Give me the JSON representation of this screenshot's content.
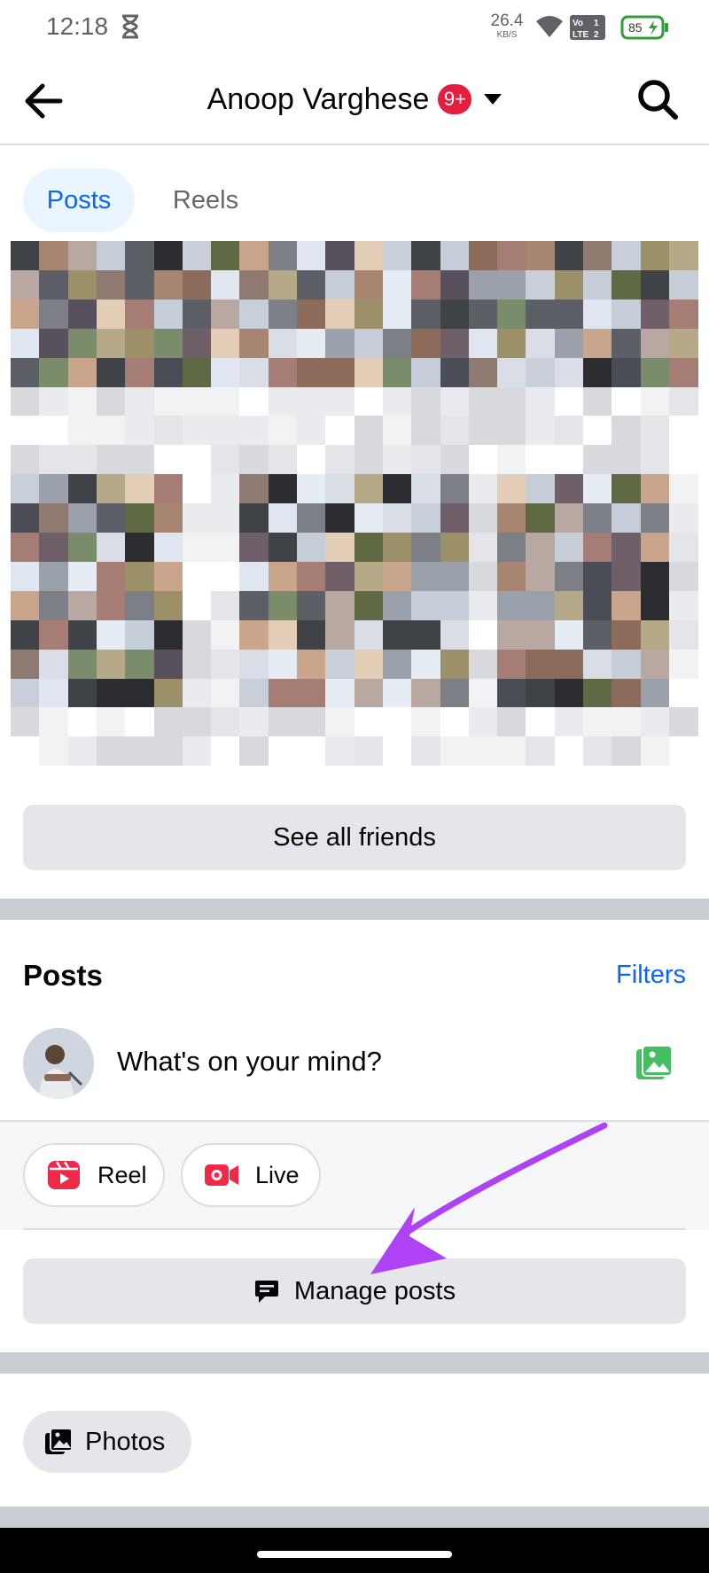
{
  "status_bar": {
    "time": "12:18",
    "speed_value": "26.4",
    "speed_unit": "KB/S",
    "volte_label": "Vo LTE 1 2",
    "battery": "85",
    "icons": [
      "hourglass-icon",
      "wifi-icon",
      "volte-icon",
      "battery-charging-icon"
    ]
  },
  "header": {
    "title": "Anoop Varghese",
    "notification_badge": "9+",
    "icons": [
      "back-arrow-icon",
      "dropdown-caret-icon",
      "search-icon"
    ]
  },
  "tabs": [
    {
      "label": "Posts",
      "active": true
    },
    {
      "label": "Reels",
      "active": false
    }
  ],
  "friends": {
    "see_all_label": "See all friends"
  },
  "posts_section": {
    "title": "Posts",
    "filters_label": "Filters",
    "composer_placeholder": "What's on your mind?",
    "chips": [
      {
        "label": "Reel",
        "icon": "reel-icon"
      },
      {
        "label": "Live",
        "icon": "live-video-icon"
      }
    ],
    "manage_posts_label": "Manage posts"
  },
  "photos": {
    "label": "Photos"
  },
  "colors": {
    "accent": "#0866ff",
    "badge": "#e41e3f",
    "annotation_arrow": "#b042f5",
    "button_gray": "#e4e6eb"
  }
}
